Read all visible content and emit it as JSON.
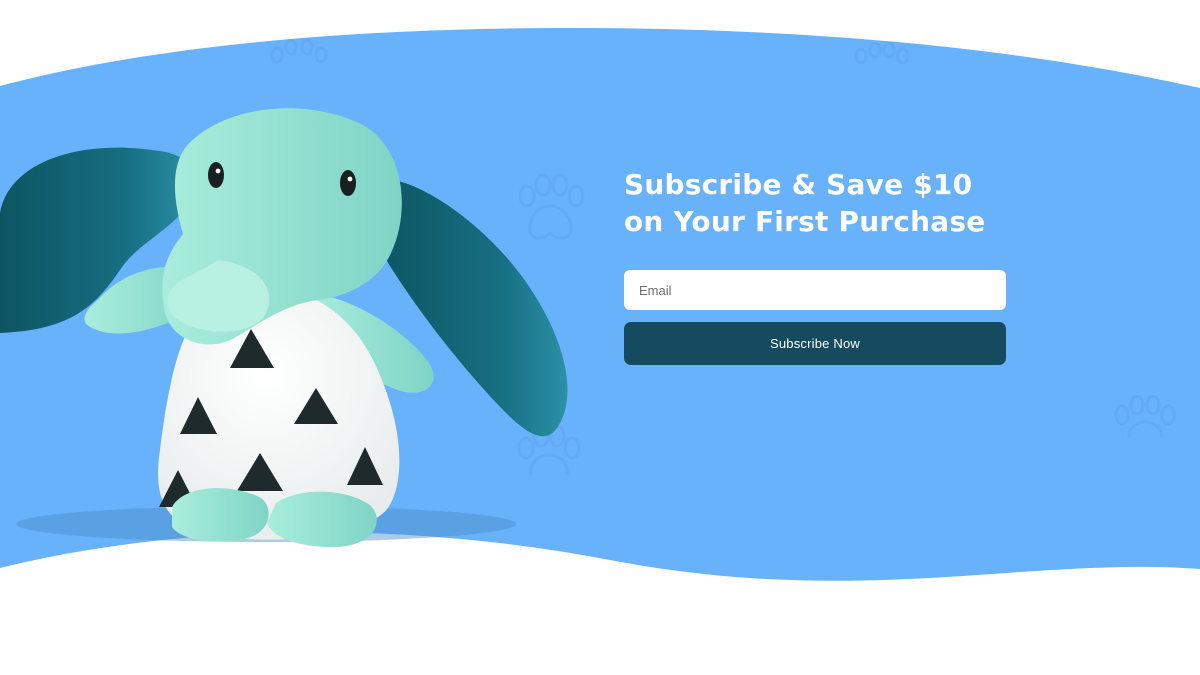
{
  "hero": {
    "background_color": "#67b2fb",
    "title_line_1": "Subscribe & Save $10",
    "title_line_2": "on Your First Purchase",
    "email_placeholder": "Email",
    "button_label": "Subscribe Now",
    "button_color": "#154b5f",
    "image_subject": "elephant-plush-toy"
  },
  "decorations": {
    "icon": "paw-print-icon",
    "color": "#5ba0ea"
  },
  "next_section": {
    "heading": ""
  }
}
